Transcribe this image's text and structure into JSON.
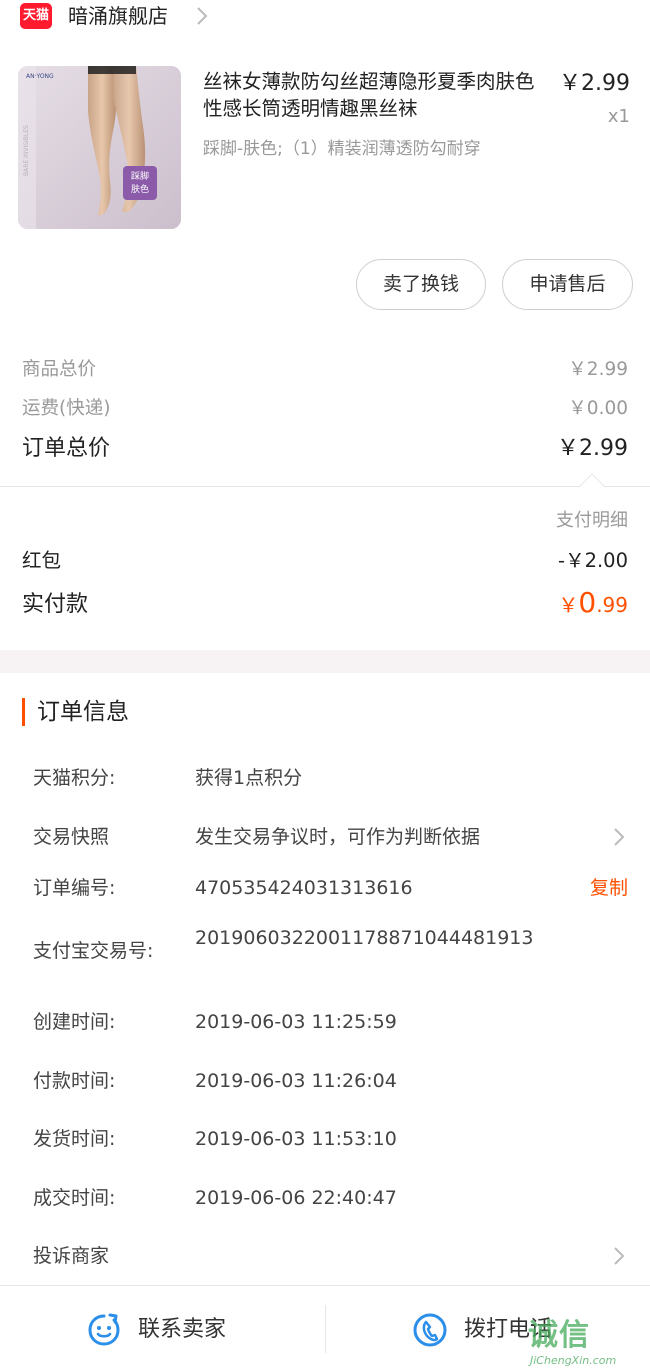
{
  "shop": {
    "logo_text": "天猫",
    "name": "暗涌旗舰店"
  },
  "product": {
    "title": "丝袜女薄款防勾丝超薄隐形夏季肉肤色性感长筒透明情趣黑丝袜",
    "sku": "踩脚-肤色;（1）精装润薄透防勾耐穿",
    "price": "￥2.99",
    "qty": "x1",
    "thumb_label": "踩脚\n肤色",
    "thumb_brand": "AN·YONG",
    "thumb_vertical": "BARE INVISIBLES"
  },
  "actions": {
    "sell_label": "卖了换钱",
    "after_sale_label": "申请售后"
  },
  "summary": {
    "goods_total_label": "商品总价",
    "goods_total_value": "￥2.99",
    "shipping_label": "运费(快递)",
    "shipping_value": "￥0.00",
    "order_total_label": "订单总价",
    "order_total_value": "￥2.99"
  },
  "payment": {
    "detail_label": "支付明细",
    "red_packet_label": "红包",
    "red_packet_value": "-￥2.00",
    "actual_label": "实付款",
    "actual_currency": "￥",
    "actual_int": "0",
    "actual_dec": ".99"
  },
  "order_info": {
    "title": "订单信息",
    "points_label": "天猫积分:",
    "points_value": "获得1点积分",
    "snapshot_label": "交易快照",
    "snapshot_value": "发生交易争议时，可作为判断依据",
    "order_no_label": "订单编号:",
    "order_no_value": "470535424031313616",
    "copy_label": "复制",
    "alipay_label": "支付宝交易号:",
    "alipay_value": "2019060322001178871044481913",
    "created_label": "创建时间:",
    "created_value": "2019-06-03 11:25:59",
    "paid_label": "付款时间:",
    "paid_value": "2019-06-03 11:26:04",
    "shipped_label": "发货时间:",
    "shipped_value": "2019-06-03 11:53:10",
    "closed_label": "成交时间:",
    "closed_value": "2019-06-06 22:40:47",
    "complain_label": "投诉商家"
  },
  "bottom_bar": {
    "contact_label": "联系卖家",
    "call_label": "拨打电话"
  },
  "watermark": {
    "text": "诚信",
    "sub": "JiChengXin.com"
  },
  "colors": {
    "accent": "#ff5000",
    "tmall_red": "#ff1a2e",
    "icon_blue": "#2b8ee8",
    "muted": "#9a9a9a"
  }
}
